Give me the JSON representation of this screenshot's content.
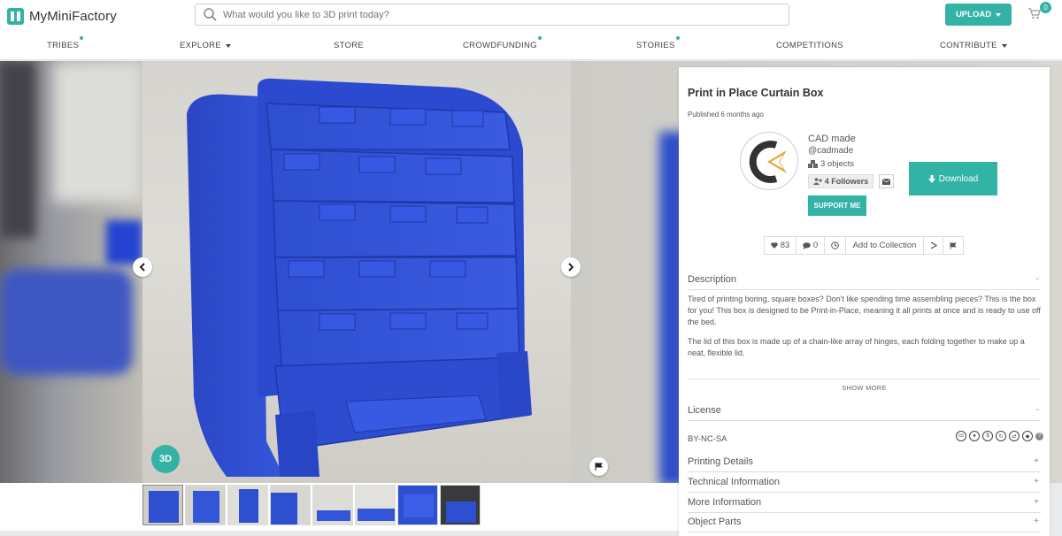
{
  "header": {
    "logo_text": "MyMiniFactory",
    "search_placeholder": "What would you like to 3D print today?",
    "upload_label": "UPLOAD",
    "cart_count": "0"
  },
  "nav": {
    "items": [
      {
        "label": "TRIBES"
      },
      {
        "label": "EXPLORE"
      },
      {
        "label": "STORE"
      },
      {
        "label": "CROWDFUNDING"
      },
      {
        "label": "STORIES"
      },
      {
        "label": "COMPETITIONS"
      },
      {
        "label": "CONTRIBUTE"
      }
    ]
  },
  "gallery": {
    "badge_3d": "3D",
    "thumbnail_count": 8
  },
  "object": {
    "title": "Print in Place Curtain Box",
    "published": "Published 6 months ago",
    "author": {
      "name": "CAD made",
      "handle": "@cadmade",
      "objects": "3 objects",
      "followers": "4 Followers",
      "support_label": "SUPPORT ME"
    },
    "download_label": "Download",
    "actions": {
      "likes": "83",
      "comments": "0",
      "add_to_collection": "Add to Collection"
    },
    "description": {
      "heading": "Description",
      "toggle": "-",
      "p1": "Tired of printing boring, square boxes? Don't like spending time assembling pieces? This is the box for you! This box is designed to be Print-in-Place, meaning it all prints at once and is ready to use off the bed.",
      "p2": "The lid of this box is made up of a chain-like array of hinges, each folding together to make up a neat, flexible lid.",
      "show_more": "SHOW MORE"
    },
    "license": {
      "heading": "License",
      "toggle": "-",
      "value": "BY-NC-SA"
    },
    "sections": [
      {
        "heading": "Printing Details",
        "toggle": "+"
      },
      {
        "heading": "Technical Information",
        "toggle": "+"
      },
      {
        "heading": "More Information",
        "toggle": "+"
      },
      {
        "heading": "Object Parts",
        "toggle": "+"
      }
    ]
  },
  "colors": {
    "accent": "#33b2a6",
    "model_blue": "#2f4fd1"
  }
}
